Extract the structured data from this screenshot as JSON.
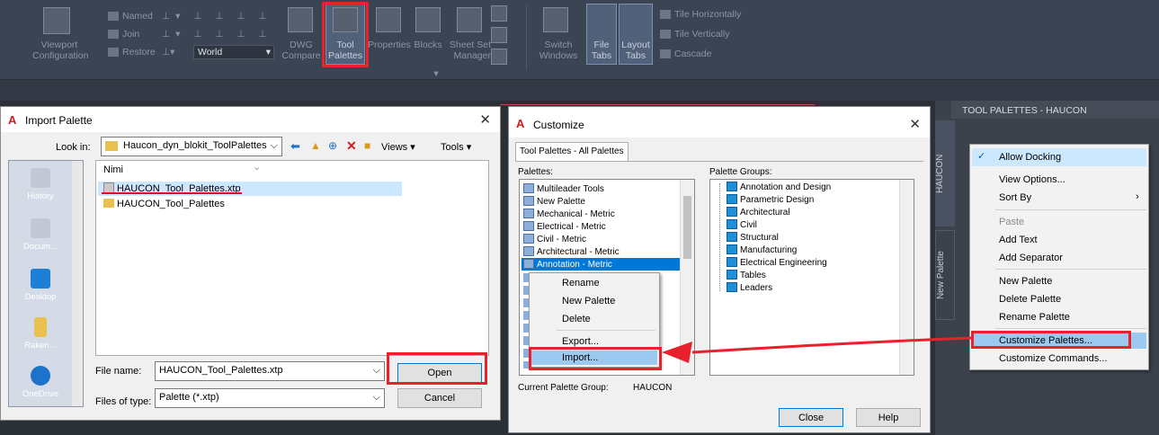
{
  "ribbon": {
    "viewport_label": "Viewport\nConfiguration",
    "named": "Named",
    "join": "Join",
    "restore": "Restore",
    "world": "World",
    "dwg_compare": "DWG\nCompare",
    "tool_palettes": "Tool\nPalettes",
    "properties": "Properties",
    "blocks": "Blocks",
    "sheet_set": "Sheet Set\nManager",
    "switch_windows": "Switch\nWindows",
    "file_tabs": "File\nTabs",
    "layout_tabs": "Layout\nTabs",
    "tile_horizontally": "Tile Horizontally",
    "tile_vertically": "Tile Vertically",
    "cascade": "Cascade"
  },
  "import_dialog": {
    "title": "Import Palette",
    "look_in_label": "Look in:",
    "look_in_value": "Haucon_dyn_blokit_ToolPalettes",
    "views": "Views",
    "tools": "Tools",
    "column_header": "Nimi",
    "files": [
      "HAUCON_Tool_Palettes.xtp",
      "HAUCON_Tool_Palettes"
    ],
    "places": [
      "History",
      "Docum...",
      "Desktop",
      "Raken...",
      "OneDrive"
    ],
    "file_name_label": "File name:",
    "file_name_value": "HAUCON_Tool_Palettes.xtp",
    "files_of_type_label": "Files of type:",
    "files_of_type_value": "Palette (*.xtp)",
    "open": "Open",
    "cancel": "Cancel"
  },
  "customize_dialog": {
    "title": "Customize",
    "tab": "Tool Palettes - All Palettes",
    "palettes_label": "Palettes:",
    "palettes": [
      "Multileader Tools",
      "New Palette",
      "Mechanical - Metric",
      "Electrical - Metric",
      "Civil - Metric",
      "Architectural - Metric",
      "Annotation - Metric"
    ],
    "palette_groups_label": "Palette Groups:",
    "groups": [
      "Annotation and Design",
      "Parametric Design",
      "Architectural",
      "Civil",
      "Structural",
      "Manufacturing",
      "Electrical Engineering",
      "Tables",
      "Leaders"
    ],
    "current_group_label": "Current Palette Group:",
    "current_group_value": "HAUCON",
    "close": "Close",
    "help": "Help"
  },
  "palette_context_menu": {
    "items": [
      "Rename",
      "New Palette",
      "Delete",
      "Export...",
      "Import..."
    ]
  },
  "tool_palettes_panel": {
    "title": "TOOL PALETTES - HAUCON",
    "tab1": "HAUCON",
    "tab2": "New Palette"
  },
  "panel_context_menu": {
    "items": [
      "Allow Docking",
      "View Options...",
      "Sort By",
      "Paste",
      "Add Text",
      "Add Separator",
      "New Palette",
      "Delete Palette",
      "Rename Palette",
      "Customize Palettes...",
      "Customize Commands..."
    ]
  },
  "colors": {
    "highlight_red": "#e8212c",
    "selection_blue": "#0078d7",
    "autocad_red": "#d21a1a"
  }
}
